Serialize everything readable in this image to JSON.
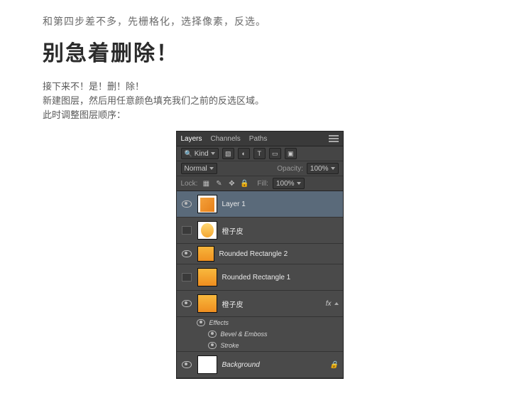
{
  "intro": "和第四步差不多，先栅格化，选择像素，反选。",
  "headline": "别急着删除！",
  "body1": "接下来不！是！删！除！",
  "body2": "新建图层，然后用任意颜色填充我们之前的反选区域。",
  "body3": "此时调整图层顺序：",
  "panel": {
    "tabs": {
      "layers": "Layers",
      "channels": "Channels",
      "paths": "Paths"
    },
    "kind": "Kind",
    "filter_t": "T",
    "blend": {
      "mode": "Normal",
      "opacity_label": "Opacity:",
      "opacity": "100%"
    },
    "lock": {
      "label": "Lock:",
      "fill_label": "Fill:",
      "fill": "100%"
    },
    "fx_label": "fx",
    "layers": [
      {
        "name": "Layer 1"
      },
      {
        "name": "橙子皮"
      },
      {
        "name": "Rounded Rectangle 2"
      },
      {
        "name": "Rounded Rectangle 1"
      },
      {
        "name": "橙子皮"
      },
      {
        "name": "Background"
      }
    ],
    "effects": {
      "title": "Effects",
      "bevel": "Bevel & Emboss",
      "stroke": "Stroke"
    }
  }
}
